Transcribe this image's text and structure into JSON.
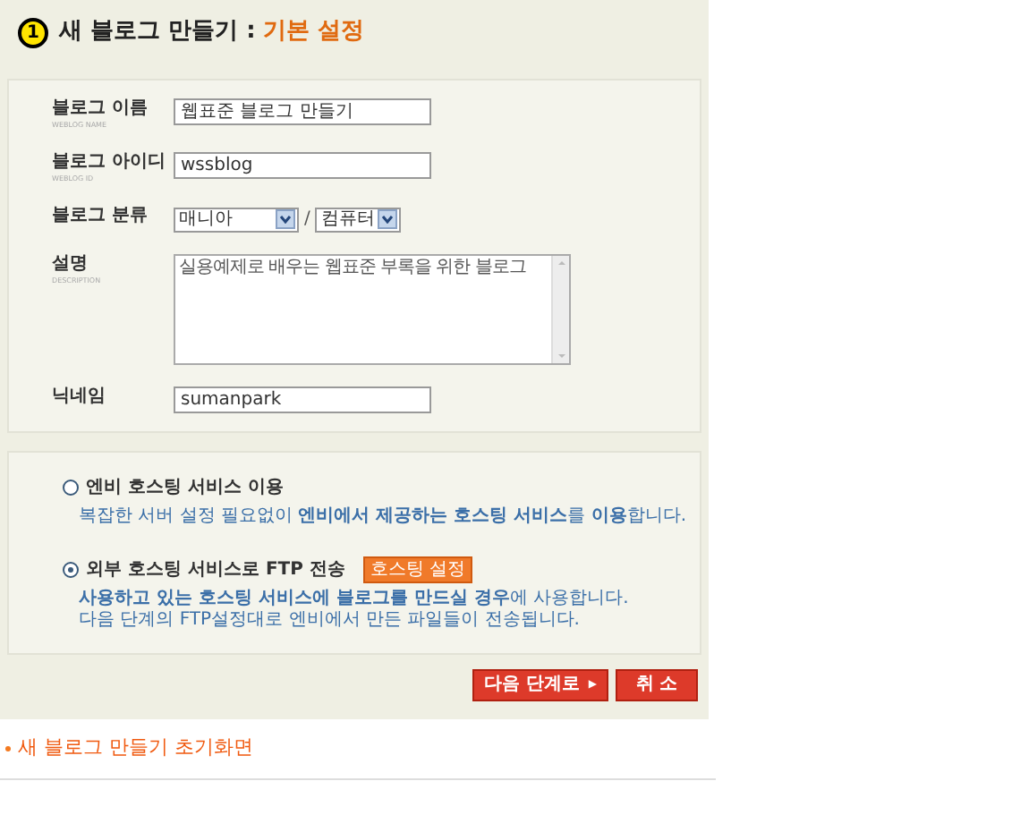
{
  "header": {
    "step": "1",
    "title": "새 블로그 만들기 :",
    "subtitle": "기본 설정"
  },
  "fields": [
    {
      "kind": "text",
      "label": "블로그 이름",
      "sublabel": "WEBLOG NAME",
      "value": "웹표준 블로그 만들기"
    },
    {
      "kind": "text",
      "label": "블로그 아이디",
      "sublabel": "WEBLOG ID",
      "value": "wssblog"
    },
    {
      "kind": "select",
      "label": "블로그 분류",
      "values": [
        "매니아",
        "컴퓨터"
      ],
      "separator": "/"
    },
    {
      "kind": "textarea",
      "label": "설명",
      "sublabel": "DESCRIPTION",
      "value": "실용예제로 배우는 웹표준 부록을 위한 블로그"
    },
    {
      "kind": "text",
      "label": "닉네임",
      "value": "sumanpark"
    }
  ],
  "hosting_options": [
    {
      "label": "엔비 호스팅 서비스 이용",
      "selected": false,
      "lines": [
        "복잡한 서버 설정 필요없이 **엔비에서 제공하는 호스팅 서비스**를 **이용**합니다."
      ]
    },
    {
      "label": "외부 호스팅 서비스로 FTP 전송",
      "selected": true,
      "button": "호스팅 설정",
      "lines": [
        "**사용하고 있는 호스팅 서비스에 블로그를 만드실 경우**에 사용합니다.",
        "다음 단계의 FTP설정대로 엔비에서 만든 파일들이 전송됩니다."
      ]
    }
  ],
  "buttons": [
    {
      "label": "다음 단계로",
      "arrow": "▶"
    },
    {
      "label": "취 소"
    }
  ],
  "caption": "새 블로그 만들기 초기화면"
}
